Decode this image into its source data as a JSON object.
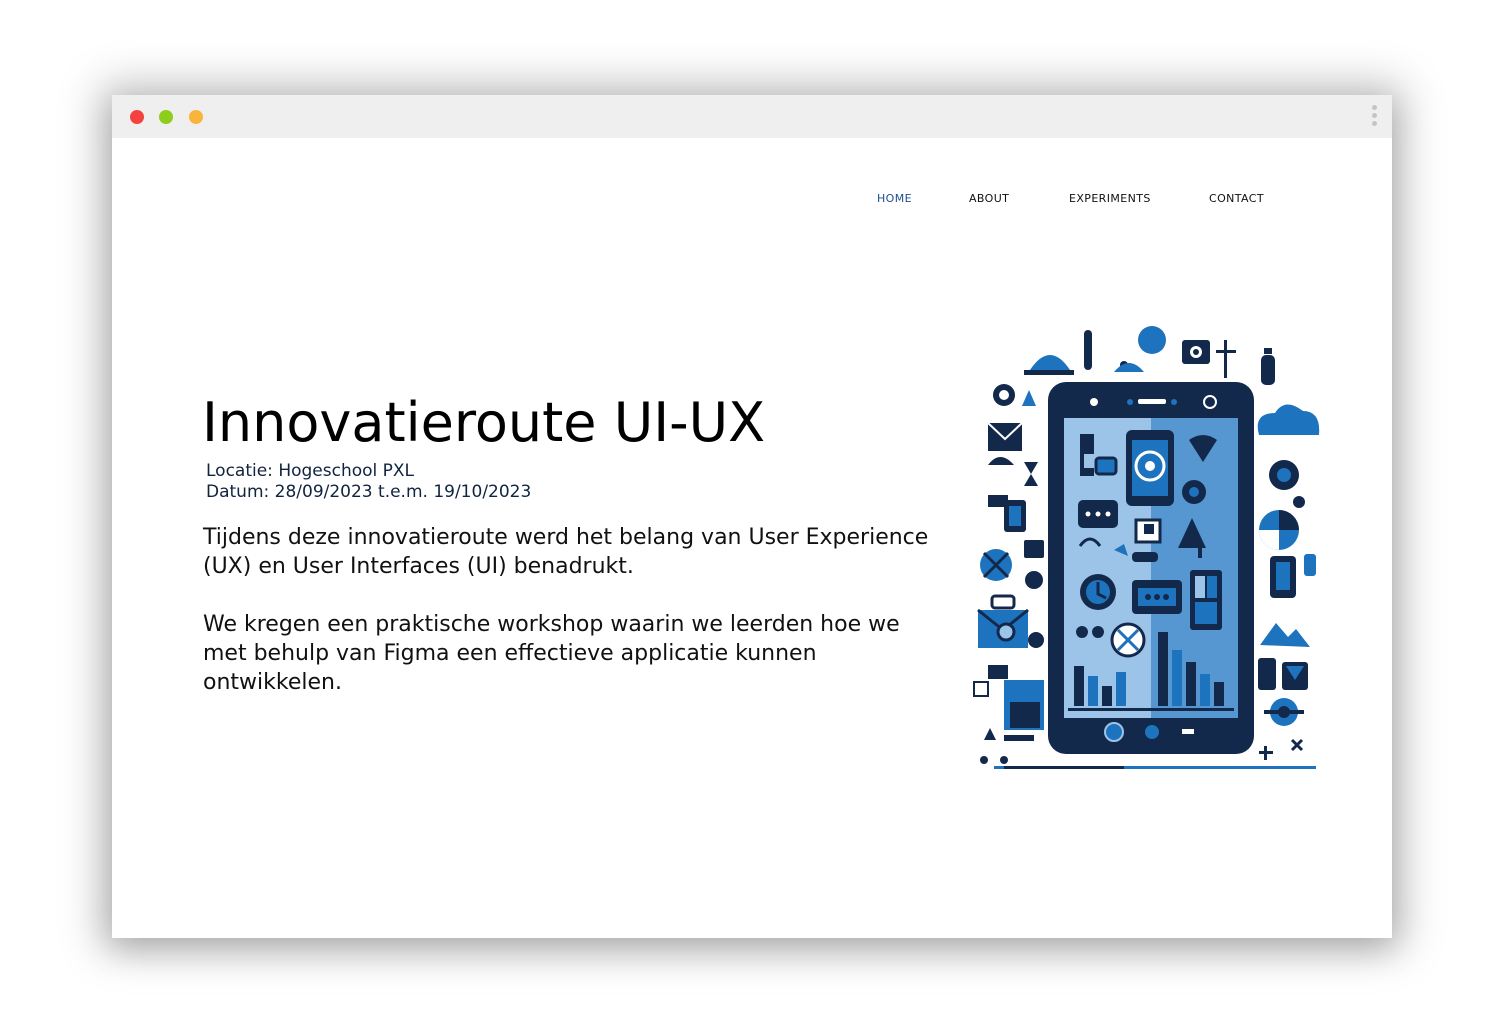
{
  "nav": {
    "items": [
      "HOME",
      "ABOUT",
      "EXPERIMENTS",
      "CONTACT"
    ],
    "active": "HOME"
  },
  "hero": {
    "title": "Innovatieroute UI-UX",
    "location": "Locatie: Hogeschool PXL",
    "date": "Datum: 28/09/2023 t.e.m. 19/10/2023",
    "paragraph1": "Tijdens deze innovatieroute werd het belang van User Experience (UX) en User Interfaces (UI) benadrukt.",
    "paragraph2": "We kregen een praktische workshop waarin we leerden hoe we met behulp van Figma een effectieve applicatie kunnen ontwikkelen."
  },
  "illustration": {
    "icon": "smartphone-ui-ux-illustration-icon"
  },
  "colors": {
    "titlebar": "#efefef",
    "traffic_red": "#f4433f",
    "traffic_green": "#8ccd1e",
    "traffic_yellow": "#fbb43b",
    "nav_active": "#1f4e8c",
    "meta_text": "#10243f",
    "phone_dark": "#13294b",
    "accent_blue": "#1e73be",
    "light_blue": "#9cc4e8"
  }
}
